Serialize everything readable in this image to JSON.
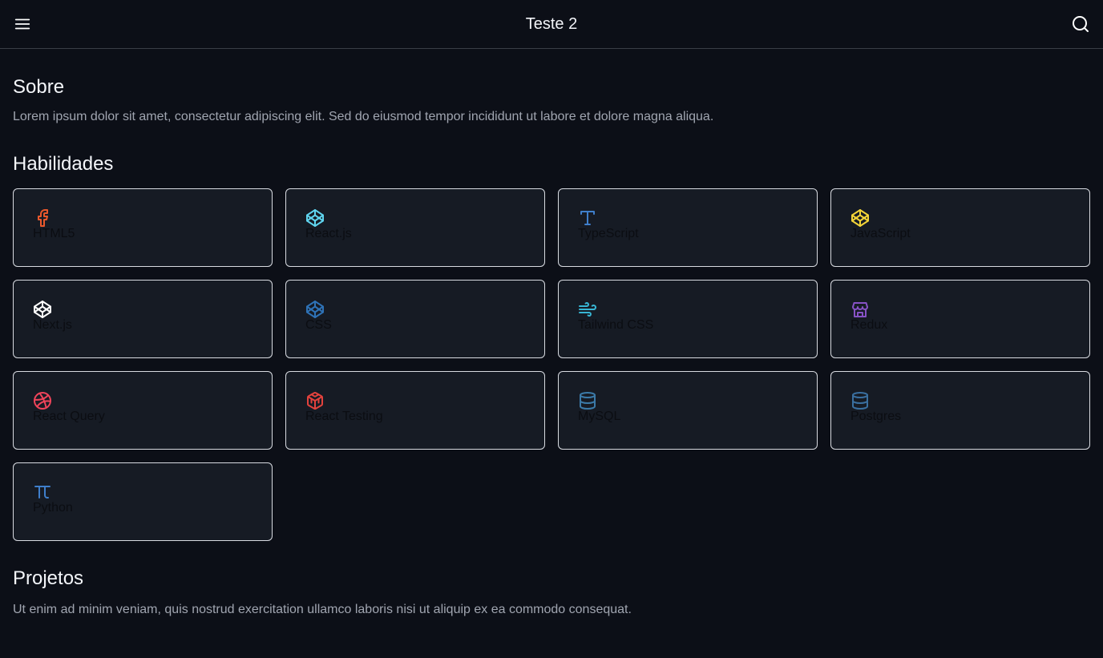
{
  "header": {
    "title": "Teste 2",
    "menu_icon": "hamburger-menu-icon",
    "search_icon": "search-icon"
  },
  "sobre": {
    "title": "Sobre",
    "text": "Lorem ipsum dolor sit amet, consectetur adipiscing elit. Sed do eiusmod tempor incididunt ut labore et dolore magna aliqua."
  },
  "habilidades": {
    "title": "Habilidades",
    "skills": [
      {
        "label": "HTML5",
        "icon": "facebook-icon",
        "color": "#e9582c"
      },
      {
        "label": "React.js",
        "icon": "codepen-icon",
        "color": "#5fd4ee"
      },
      {
        "label": "TypeScript",
        "icon": "type-icon",
        "color": "#3f7fcb"
      },
      {
        "label": "JavaScript",
        "icon": "codepen-icon",
        "color": "#f3d438"
      },
      {
        "label": "Next.js",
        "icon": "codepen-icon",
        "color": "#ffffff"
      },
      {
        "label": "CSS",
        "icon": "codepen-icon",
        "color": "#2e72b6"
      },
      {
        "label": "Tailwind CSS",
        "icon": "wind-icon",
        "color": "#38b6d4"
      },
      {
        "label": "Redux",
        "icon": "store-icon",
        "color": "#8752c5"
      },
      {
        "label": "React Query",
        "icon": "dribbble-icon",
        "color": "#f0445a"
      },
      {
        "label": "React Testing",
        "icon": "box-icon",
        "color": "#e3423d"
      },
      {
        "label": "MySQL",
        "icon": "database-icon",
        "color": "#3b7aa8"
      },
      {
        "label": "Postgres",
        "icon": "database-icon",
        "color": "#3a6f9f"
      },
      {
        "label": "Python",
        "icon": "pi-icon",
        "color": "#3f7fcb"
      }
    ]
  },
  "projetos": {
    "title": "Projetos",
    "text": "Ut enim ad minim veniam, quis nostrud exercitation ullamco laboris nisi ut aliquip ex ea commodo consequat."
  },
  "colors": {
    "background": "#0c0f17",
    "card_background": "#161b24",
    "card_border": "#d8dbe1"
  }
}
